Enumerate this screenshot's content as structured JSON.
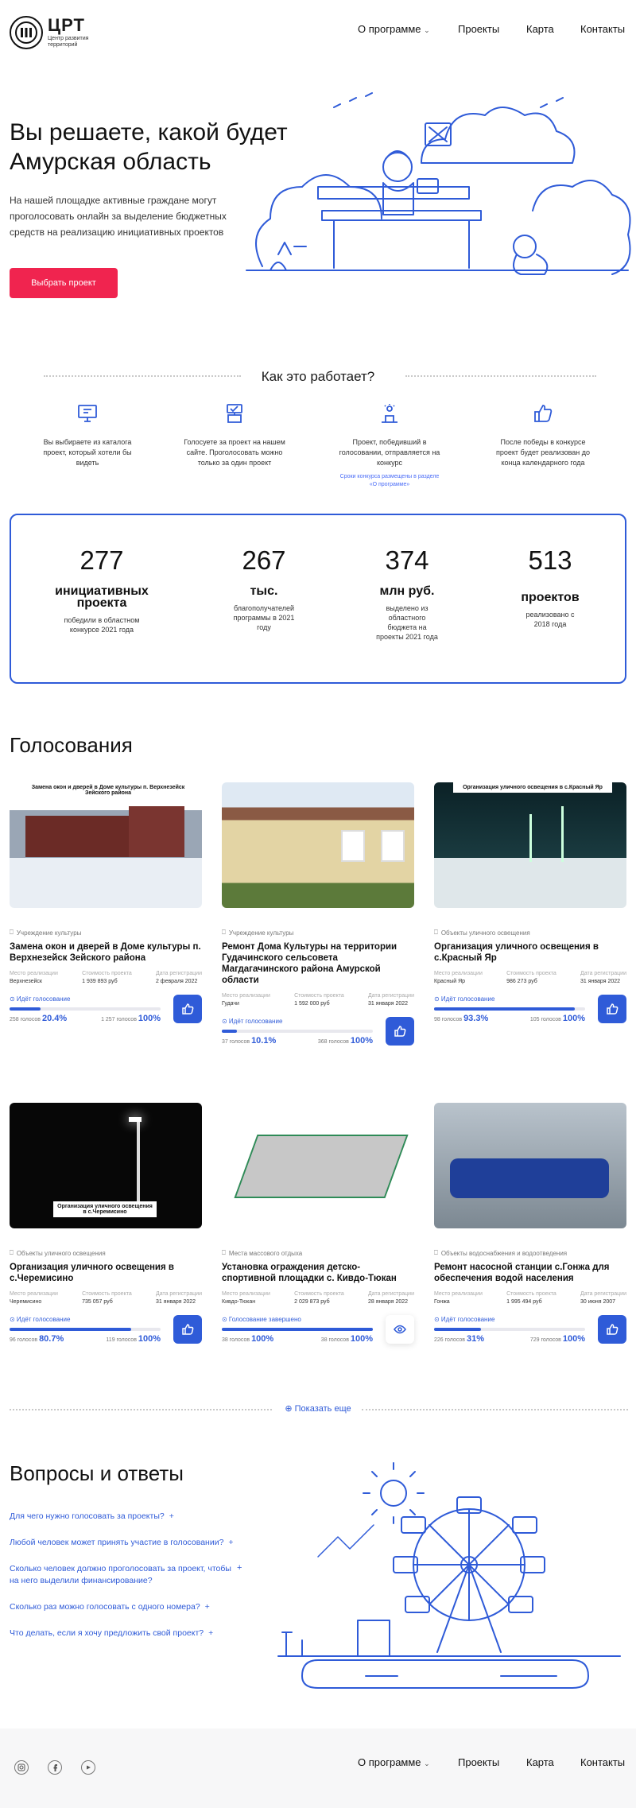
{
  "header": {
    "logo": {
      "mark": "ЦРТ",
      "title": "ЦРТ",
      "subtitle": "Центр развития территорий"
    },
    "nav": [
      {
        "label": "О программе",
        "has_dropdown": true
      },
      {
        "label": "Проекты"
      },
      {
        "label": "Карта"
      },
      {
        "label": "Контакты"
      }
    ]
  },
  "hero": {
    "title_line1": "Вы решаете, какой будет",
    "title_line2": "Амурская область",
    "text": "На нашей площадке активные граждане могут проголосовать онлайн за выделение бюджетных средств на реализацию инициативных проектов",
    "button": "Выбрать проект"
  },
  "how": {
    "title": "Как это работает?",
    "steps": [
      {
        "icon": "monitor-icon",
        "text": "Вы выбираете из каталога проект, который хотели бы видеть"
      },
      {
        "icon": "vote-icon",
        "text": "Голосуете за проект на нашем сайте. Проголосовать можно только за один проект"
      },
      {
        "icon": "winner-icon",
        "text": "Проект, победивший в голосовании, отправляется на конкурс",
        "note": "Сроки конкурса размещены в разделе «О программе»"
      },
      {
        "icon": "thumbs-up-icon",
        "text": "После победы в конкурсе проект будет реализован до конца календарного года"
      }
    ]
  },
  "stats": [
    {
      "num": "277",
      "unit": "инициативных проекта",
      "desc": "победили в областном конкурсе 2021 года"
    },
    {
      "num": "267",
      "unit": "тыс.",
      "desc": "благополучателей программы в 2021 году"
    },
    {
      "num": "374",
      "unit": "млн руб.",
      "desc": "выделено из областного бюджета на проекты 2021 года"
    },
    {
      "num": "513",
      "unit": "проектов",
      "desc": "реализовано с 2018 года"
    }
  ],
  "voting": {
    "title": "Голосования",
    "labels": {
      "place": "Место реализации",
      "cost": "Стоимость проекта",
      "date": "Дата регистрации"
    },
    "cards": [
      {
        "img_caption": "Замена окон и дверей в Доме культуры п. Верхнезейск Зейского района",
        "category": "Учреждение культуры",
        "title": "Замена окон и дверей в Доме культуры п. Верхнезейск Зейского района",
        "place": "Верхнезейск",
        "cost": "1 939 893 руб",
        "date": "2 февраля 2022",
        "status": "Идёт голосование",
        "votes": "258 голосов",
        "percent": "20.4%",
        "percent_value": 20.4,
        "target": "1 257 голосов",
        "target_pct": "100%",
        "action": "like"
      },
      {
        "img_caption": "",
        "category": "Учреждение культуры",
        "title": "Ремонт Дома Культуры на территории Гудачинского сельсовета Магдагачинского района Амурской области",
        "place": "Гудачи",
        "cost": "1 592 000 руб",
        "date": "31 января 2022",
        "status": "Идёт голосование",
        "votes": "37 голосов",
        "percent": "10.1%",
        "percent_value": 10.1,
        "target": "368 голосов",
        "target_pct": "100%",
        "action": "like"
      },
      {
        "img_caption": "Организация уличного освещения в с.Красный Яр",
        "category": "Объекты уличного освещения",
        "title": "Организация уличного освещения в с.Красный Яр",
        "place": "Красный Яр",
        "cost": "986 273 руб",
        "date": "31 января 2022",
        "status": "Идёт голосование",
        "votes": "98 голосов",
        "percent": "93.3%",
        "percent_value": 93.3,
        "target": "105 голосов",
        "target_pct": "100%",
        "action": "like"
      },
      {
        "img_caption": "Организация уличного освещения в с.Черемисино",
        "category": "Объекты уличного освещения",
        "title": "Организация уличного освещения в с.Черемисино",
        "place": "Черемисино",
        "cost": "735 057 руб",
        "date": "31 января 2022",
        "status": "Идёт голосование",
        "votes": "96 голосов",
        "percent": "80.7%",
        "percent_value": 80.7,
        "target": "119 голосов",
        "target_pct": "100%",
        "action": "like"
      },
      {
        "img_caption": "",
        "category": "Места массового отдыха",
        "title": "Установка ограждения детско-спортивной площадки с. Кивдо-Тюкан",
        "place": "Кивдо-Тюкан",
        "cost": "2 029 873 руб",
        "date": "28 января 2022",
        "status": "Голосование завершено",
        "votes": "38 голосов",
        "percent": "100%",
        "percent_value": 100,
        "target": "38 голосов",
        "target_pct": "100%",
        "action": "view"
      },
      {
        "img_caption": "",
        "category": "Объекты водоснабжения и водоотведения",
        "title": "Ремонт насосной станции с.Гонжа для обеспечения водой населения",
        "place": "Гонжа",
        "cost": "1 995 494 руб",
        "date": "30 июня 2007",
        "status": "Идёт голосование",
        "votes": "226 голосов",
        "percent": "31%",
        "percent_value": 31,
        "target": "729 голосов",
        "target_pct": "100%",
        "action": "like"
      }
    ],
    "show_more": "Показать еще"
  },
  "faq": {
    "title": "Вопросы и ответы",
    "items": [
      "Для чего нужно голосовать за проекты?",
      "Любой человек может принять участие в голосовании?",
      "Сколько человек должно проголосовать за проект, чтобы на него выделили финансирование?",
      "Сколько раз можно голосовать с одного номера?",
      "Что делать, если я хочу предложить свой проект?"
    ],
    "plus": "+"
  },
  "footer": {
    "social": [
      "instagram-icon",
      "facebook-icon",
      "youtube-icon"
    ],
    "nav": [
      {
        "label": "О программе",
        "has_dropdown": true
      },
      {
        "label": "Проекты"
      },
      {
        "label": "Карта"
      },
      {
        "label": "Контакты"
      }
    ]
  },
  "colors": {
    "accent": "#2f5bd8",
    "button": "#f0244f",
    "text": "#1a1a1a"
  }
}
